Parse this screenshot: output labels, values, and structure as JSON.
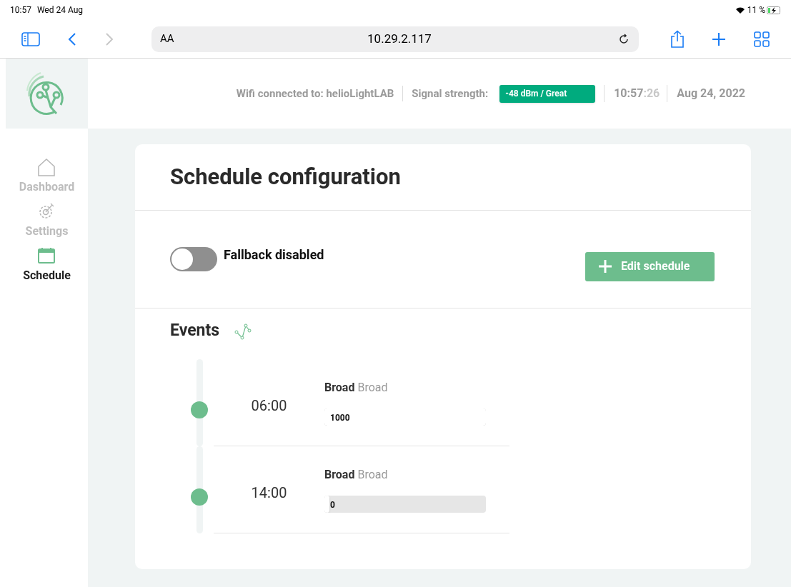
{
  "status_bar": {
    "time": "10:57",
    "date": "Wed 24 Aug",
    "battery": "11 %"
  },
  "browser": {
    "text_size": "AA",
    "url": "10.29.2.117"
  },
  "header": {
    "wifi": "Wifi connected to: helioLightLAB",
    "signal_label": "Signal strength:",
    "signal_value": "-48 dBm / Great",
    "time": "10:57",
    "seconds": ":26",
    "date": "Aug 24, 2022"
  },
  "sidebar": {
    "items": [
      {
        "kind": "home",
        "label": "Dashboard",
        "selected": false
      },
      {
        "kind": "gear",
        "label": "Settings",
        "selected": false
      },
      {
        "kind": "calendar",
        "label": "Schedule",
        "selected": true
      }
    ]
  },
  "page": {
    "title": "Schedule configuration",
    "fallback": {
      "label": "Fallback disabled",
      "on": false
    },
    "edit_button": "Edit schedule",
    "events_title": "Events",
    "events": [
      {
        "time": "06:00",
        "name": "Broad",
        "type": "Broad",
        "value": "1000",
        "level": 1
      },
      {
        "time": "14:00",
        "name": "Broad",
        "type": "Broad",
        "value": "0",
        "level": 0
      }
    ]
  }
}
